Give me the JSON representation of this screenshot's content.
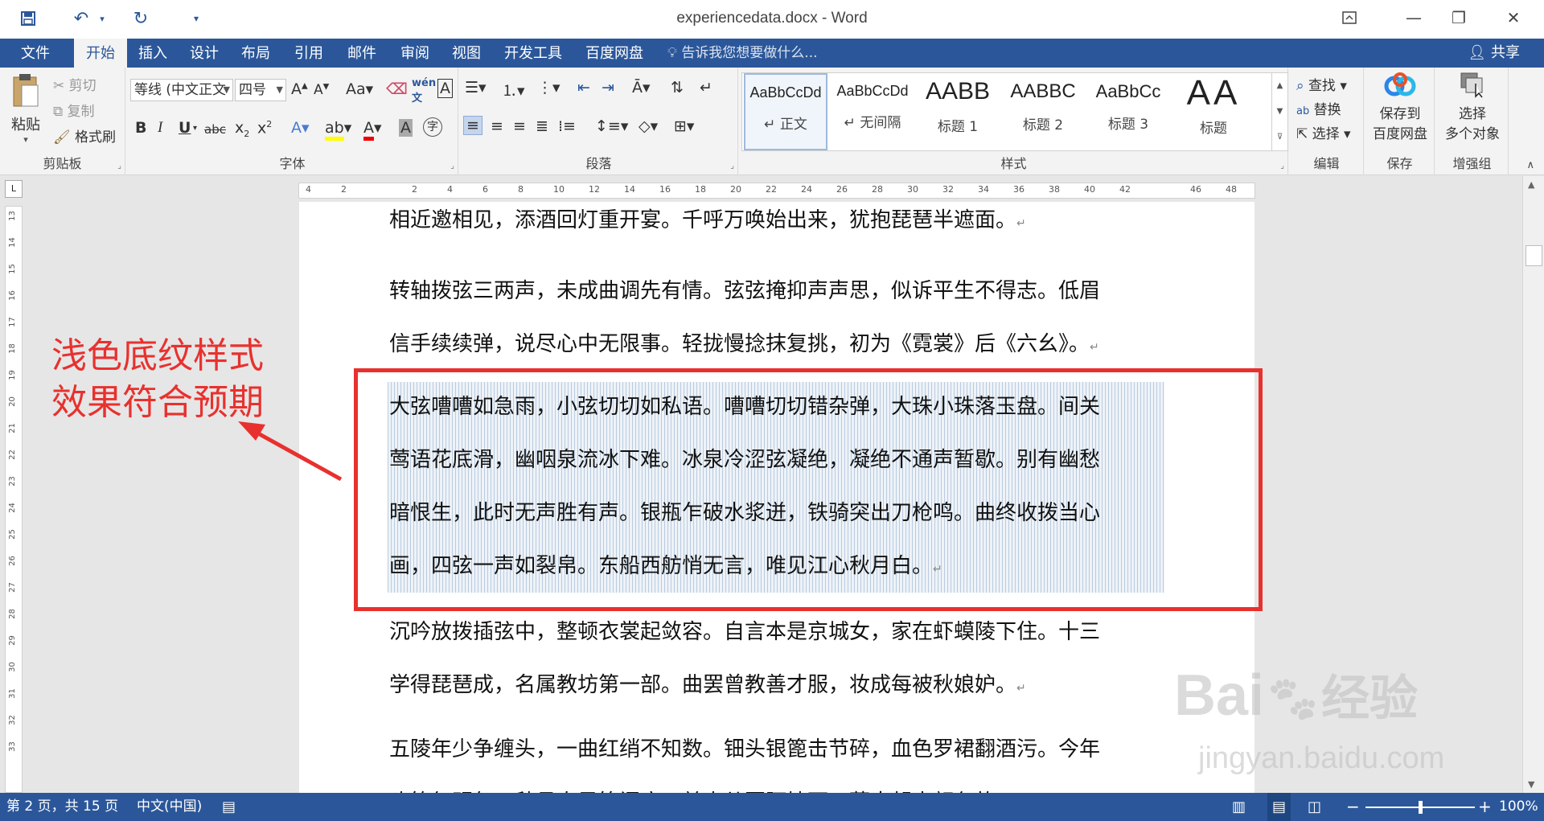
{
  "window": {
    "title": "experiencedata.docx - Word"
  },
  "qat": {
    "save_icon": "save-icon",
    "undo_icon": "undo-icon",
    "redo_icon": "redo-icon",
    "customize_icon": "customize-icon"
  },
  "tabs": [
    "文件",
    "开始",
    "插入",
    "设计",
    "布局",
    "引用",
    "邮件",
    "审阅",
    "视图",
    "开发工具",
    "百度网盘"
  ],
  "tellme": "告诉我您想要做什么...",
  "share": "共享",
  "clipboard": {
    "paste": "粘贴",
    "cut": "剪切",
    "copy": "复制",
    "painter": "格式刷",
    "label": "剪贴板"
  },
  "font": {
    "name": "等线 (中文正文",
    "size": "四号",
    "label": "字体"
  },
  "paragraph": {
    "label": "段落"
  },
  "styles": {
    "items": [
      {
        "preview": "AaBbCcDd",
        "name": "正文"
      },
      {
        "preview": "AaBbCcDd",
        "name": "无间隔"
      },
      {
        "preview": "AABB",
        "name": "标题 1"
      },
      {
        "preview": "AABBC",
        "name": "标题 2"
      },
      {
        "preview": "AaBbCc",
        "name": "标题 3"
      },
      {
        "preview": "AA",
        "name": "标题"
      }
    ],
    "label": "样式"
  },
  "editing": {
    "find": "查找",
    "replace": "替换",
    "select": "选择",
    "label": "编辑"
  },
  "baidu": {
    "save_line1": "保存到",
    "save_line2": "百度网盘",
    "label": "保存"
  },
  "enhance": {
    "select_line1": "选择",
    "select_line2": "多个对象",
    "label": "增强组"
  },
  "ruler_marks": [
    "4",
    "2",
    "",
    "2",
    "4",
    "6",
    "8",
    "10",
    "12",
    "14",
    "16",
    "18",
    "20",
    "22",
    "24",
    "26",
    "28",
    "30",
    "32",
    "34",
    "36",
    "38",
    "40",
    "42",
    "",
    "46",
    "48"
  ],
  "vruler_marks": [
    "13",
    "14",
    "15",
    "16",
    "17",
    "18",
    "19",
    "20",
    "21",
    "22",
    "23",
    "24",
    "25",
    "26",
    "27",
    "28",
    "29",
    "30",
    "31",
    "32",
    "33"
  ],
  "document": {
    "p1": "相近邀相见，添酒回灯重开宴。千呼万唤始出来，犹抱琵琶半遮面。",
    "p2a": "转轴拨弦三两声，未成曲调先有情。弦弦掩抑声声思，似诉平生不得志。低眉",
    "p2b": "信手续续弹，说尽心中无限事。轻拢慢捻抹复挑，初为《霓裳》后《六幺》。",
    "p3a": "大弦嘈嘈如急雨，小弦切切如私语。嘈嘈切切错杂弹，大珠小珠落玉盘。间关",
    "p3b": "莺语花底滑，幽咽泉流冰下难。冰泉冷涩弦凝绝，凝绝不通声暂歇。别有幽愁",
    "p3c": "暗恨生，此时无声胜有声。银瓶乍破水浆迸，铁骑突出刀枪鸣。曲终收拨当心",
    "p3d": "画，四弦一声如裂帛。东船西舫悄无言，唯见江心秋月白。",
    "p4a": "沉吟放拨插弦中，整顿衣裳起敛容。自言本是京城女，家在虾蟆陵下住。十三",
    "p4b": "学得琵琶成，名属教坊第一部。曲罢曾教善才服，妆成每被秋娘妒。",
    "p5a": "五陵年少争缠头，一曲红绡不知数。钿头银篦击节碎，血色罗裙翻酒污。今年",
    "p5b": "欢笑复明年，秋月春风等闲度。弟走从军阿姨死，暮去朝来颜色故。"
  },
  "annotation": {
    "line1": "浅色底纹样式",
    "line2": "效果符合预期"
  },
  "status": {
    "page": "第 2 页，共 15 页",
    "language": "中文(中国)",
    "zoom": "100%"
  },
  "watermark": {
    "brand": "Bai",
    "brand2": "经验",
    "url": "jingyan.baidu.com"
  },
  "colors": {
    "accent": "#2b579a",
    "annotation": "#e8312e"
  }
}
